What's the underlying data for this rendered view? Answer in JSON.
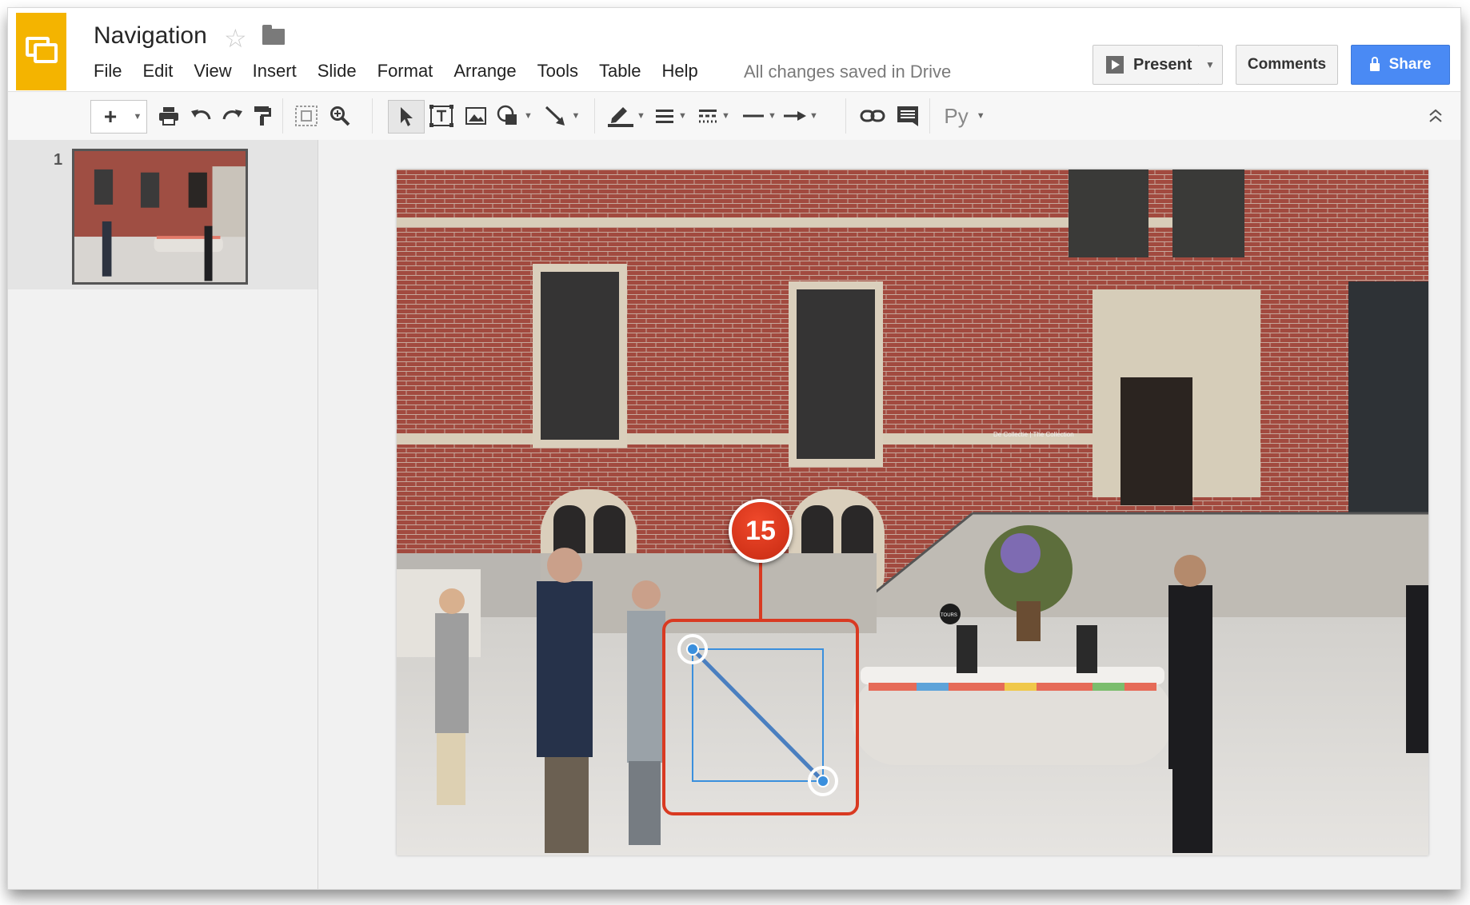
{
  "header": {
    "doc_title": "Navigation",
    "saved_status": "All changes saved in Drive",
    "present_label": "Present",
    "comments_label": "Comments",
    "share_label": "Share"
  },
  "menu": {
    "items": [
      "File",
      "Edit",
      "View",
      "Insert",
      "Slide",
      "Format",
      "Arrange",
      "Tools",
      "Table",
      "Help"
    ]
  },
  "toolbar": {
    "new_slide_label": "+",
    "input_tools_label": "Py"
  },
  "sidebar": {
    "slide_number": "1"
  },
  "slide": {
    "annotation_number": "15",
    "sign_text": "De Collectie | The Collection",
    "tours_text": "TOURS"
  },
  "icons": {
    "star": "star-icon",
    "folder": "folder-icon",
    "print": "print-icon",
    "undo": "undo-icon",
    "redo": "redo-icon",
    "paint_format": "paint-format-icon",
    "zoom_fit": "zoom-fit-icon",
    "zoom": "zoom-icon",
    "select": "cursor-icon",
    "text_box": "text-box-icon",
    "image": "image-icon",
    "shape": "shape-icon",
    "line": "line-icon",
    "border_color": "border-color-icon",
    "line_weight": "line-weight-icon",
    "line_dash": "line-dash-icon",
    "line_start": "line-start-icon",
    "line_end": "line-end-icon",
    "link": "link-icon",
    "comment": "comment-icon",
    "collapse": "chevron-up-double-icon"
  },
  "colors": {
    "logo": "#f4b400",
    "share_button": "#4a8af4",
    "highlight_box": "#d93a22",
    "selection": "#3a8fdd"
  }
}
